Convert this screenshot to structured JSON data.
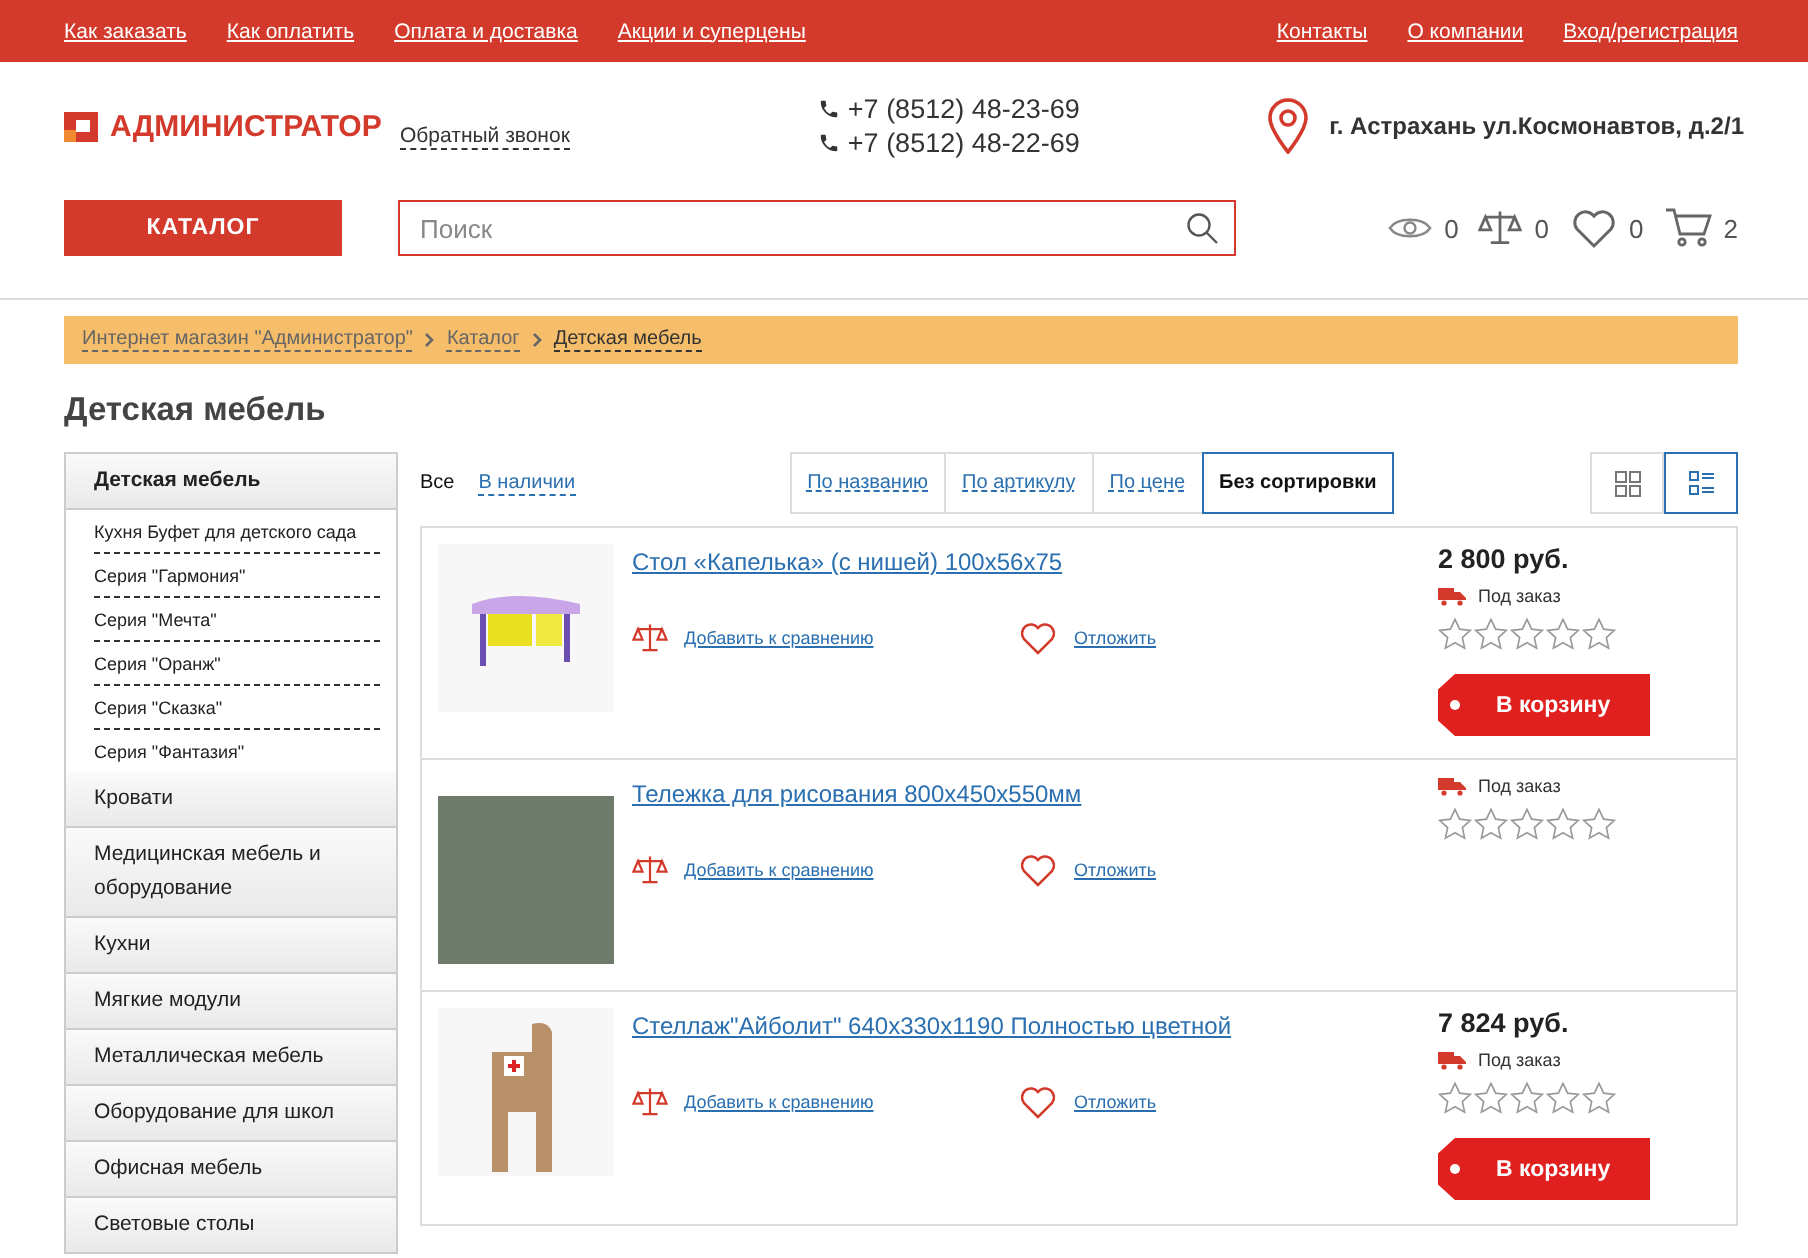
{
  "top_nav": {
    "left": [
      "Как заказать",
      "Как оплатить",
      "Оплата и доставка",
      "Акции и суперцены"
    ],
    "right": [
      "Контакты",
      "О компании",
      "Вход/регистрация"
    ]
  },
  "header": {
    "logo": "АДМИНИСТРАТОР",
    "callback": "Обратный звонок",
    "phones": [
      "+7 (8512) 48-23-69",
      "+7 (8512) 48-22-69"
    ],
    "address": "г. Астрахань ул.Космонавтов, д.2/1"
  },
  "toolbar": {
    "catalog_button": "КАТАЛОГ",
    "search": {
      "placeholder": "Поиск"
    },
    "counters": [
      {
        "kind": "views",
        "count": "0"
      },
      {
        "kind": "compare",
        "count": "0"
      },
      {
        "kind": "favorites",
        "count": "0"
      },
      {
        "kind": "cart",
        "count": "2"
      }
    ]
  },
  "breadcrumbs": [
    "Интернет магазин \"Администратор\"",
    "Каталог",
    "Детская мебель"
  ],
  "page_title": "Детская мебель",
  "sidebar": {
    "items": [
      {
        "label": "Детская мебель",
        "selected": true,
        "children": [
          {
            "label": "Кухня Буфет для детского сада"
          },
          {
            "label": "Серия \"Гармония\""
          },
          {
            "label": "Серия \"Мечта\""
          },
          {
            "label": "Серия \"Оранж\""
          },
          {
            "label": "Серия \"Сказка\""
          },
          {
            "label": "Серия \"Фантазия\""
          }
        ]
      },
      {
        "label": "Кровати",
        "selected": false
      },
      {
        "label": "Медицинская мебель и оборудование",
        "selected": false
      },
      {
        "label": "Кухни",
        "selected": false
      },
      {
        "label": "Мягкие модули",
        "selected": false
      },
      {
        "label": "Металлическая мебель",
        "selected": false
      },
      {
        "label": "Оборудование для школ",
        "selected": false
      },
      {
        "label": "Офисная мебель",
        "selected": false
      },
      {
        "label": "Световые столы",
        "selected": false
      }
    ]
  },
  "filters": [
    {
      "label": "Все",
      "selected": true
    },
    {
      "label": "В наличии",
      "selected": false
    }
  ],
  "sort_tabs": [
    {
      "label": "По названию",
      "selected": false
    },
    {
      "label": "По артикулу",
      "selected": false
    },
    {
      "label": "По цене",
      "selected": false
    },
    {
      "label": "Без сортировки",
      "selected": true
    }
  ],
  "view_toggles": [
    {
      "kind": "grid",
      "selected": false
    },
    {
      "kind": "list",
      "selected": true
    }
  ],
  "products": [
    {
      "kind": "desk",
      "title": "Стол «Капелька» (с нишей) 100х56х75",
      "compare": "Добавить к сравнению",
      "favorite": "Отложить",
      "price": "2 800 руб.",
      "availability": "Под заказ",
      "stars": 0,
      "cart_button": "В корзину"
    },
    {
      "kind": "cart",
      "title": "Тележка для рисования 800х450х550мм",
      "compare": "Добавить к сравнению",
      "favorite": "Отложить",
      "availability": "Под заказ",
      "stars": 0
    },
    {
      "kind": "shelf",
      "title": "Стеллаж\"Айболит\" 640х330х1190 Полностью цветной",
      "compare": "Добавить к сравнению",
      "favorite": "Отложить",
      "price": "7 824 руб.",
      "availability": "Под заказ",
      "stars": 0,
      "cart_button": "В корзину"
    }
  ]
}
